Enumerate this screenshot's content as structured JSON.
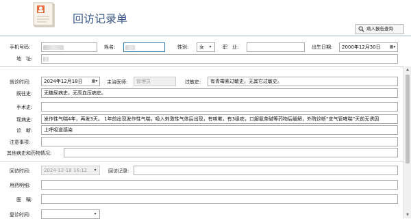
{
  "header": {
    "title": "回访记录单",
    "query_button": "病人报告查询"
  },
  "patient": {
    "phone_label": "手机号码:",
    "name_label": "姓名:",
    "gender_label": "性别:",
    "gender_value": "女",
    "occupation_label": "职　业:",
    "birth_label": "出生日期:",
    "birth_value": "2000年12月30日",
    "address_label": "地　址:"
  },
  "visit": {
    "visit_time_label": "就诊时间:",
    "visit_time_value": "2024年12月18日",
    "doctor_label": "主治医师:",
    "doctor_value": "管理员",
    "allergy_label": "过敏史:",
    "allergy_value": "有青霉素过敏史，无其它过敏史。",
    "past_label": "既往史:",
    "past_value": "无糖尿病史，无高血压病史。",
    "surgery_label": "手术史:",
    "present_label": "现病史:",
    "present_value": "发作性气喘4年，再发3天。 1年前出现发作性气喘，吸入刺激性气体后出现，有咳嗽，有3级痰，口服氨茶碱等药物后缓解，外院诊断“支气管哮喘”天前无诱因",
    "diagnosis_label": "诊　断:",
    "diagnosis_value": "上呼吸道感染",
    "notes_label": "注意事项:",
    "other_label": "其他病史和药物情况:"
  },
  "followup": {
    "time_label": "回访时间:",
    "time_value": "2024-12-18 16:12",
    "record_label": "回访记录:",
    "med_label": "用药明细:",
    "advice_label": "医　嘱:",
    "revisit_label": "复诊时间:"
  },
  "colors": {
    "title": "#3c5a8a",
    "border": "#a9a9a9",
    "focus": "#3c7fb1"
  }
}
